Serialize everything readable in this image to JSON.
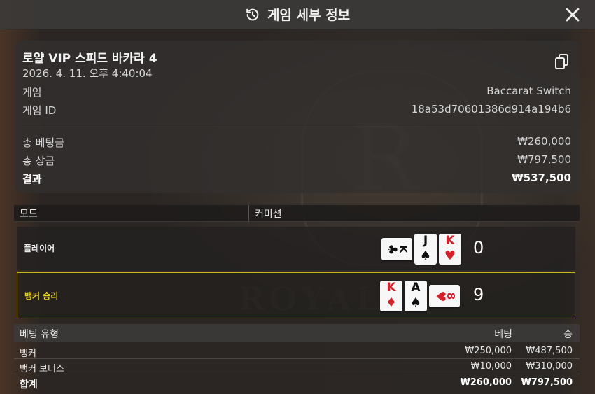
{
  "header": {
    "title": "게임 세부 정보"
  },
  "details": {
    "title": "로얄 VIP 스피드 바카라 4",
    "datetime": "2026. 4. 11. 오후 4:40:04",
    "game_label": "게임",
    "game_value": "Baccarat Switch",
    "game_id_label": "게임 ID",
    "game_id_value": "18a53d70601386d914a194b6",
    "total_bet_label": "총 베팅금",
    "total_bet_value": "₩260,000",
    "total_win_label": "총 상금",
    "total_win_value": "₩797,500",
    "result_label": "결과",
    "result_value": "₩537,500"
  },
  "mode_bar": {
    "mode_label": "모드",
    "commission_label": "커미션"
  },
  "hands": {
    "player": {
      "label": "플레이어",
      "score": "0",
      "cards": [
        {
          "rank": "K",
          "suit": "♣",
          "color": "#111111",
          "orientation": "horizontal"
        },
        {
          "rank": "J",
          "suit": "♠",
          "color": "#111111",
          "orientation": "vertical"
        },
        {
          "rank": "K",
          "suit": "♥",
          "color": "#d8202a",
          "orientation": "vertical"
        }
      ]
    },
    "banker": {
      "label": "뱅커 승리",
      "score": "9",
      "cards": [
        {
          "rank": "K",
          "suit": "♦",
          "color": "#d8202a",
          "orientation": "vertical"
        },
        {
          "rank": "A",
          "suit": "♠",
          "color": "#111111",
          "orientation": "vertical"
        },
        {
          "rank": "8",
          "suit": "♥",
          "color": "#d8202a",
          "orientation": "horizontal"
        }
      ]
    }
  },
  "bets": {
    "columns": {
      "type": "베팅 유형",
      "bet": "베팅",
      "win": "승"
    },
    "rows": [
      {
        "type": "뱅커",
        "bet": "₩250,000",
        "win": "₩487,500"
      },
      {
        "type": "뱅커 보너스",
        "bet": "₩10,000",
        "win": "₩310,000"
      }
    ],
    "total": {
      "type": "합계",
      "bet": "₩260,000",
      "win": "₩797,500"
    }
  },
  "colors": {
    "winner_border": "#c9b11f",
    "winner_text": "#e8d21c",
    "red_suit": "#d8202a"
  },
  "icons": {
    "header": "history-icon",
    "close": "close-icon",
    "copy": "copy-icon"
  }
}
